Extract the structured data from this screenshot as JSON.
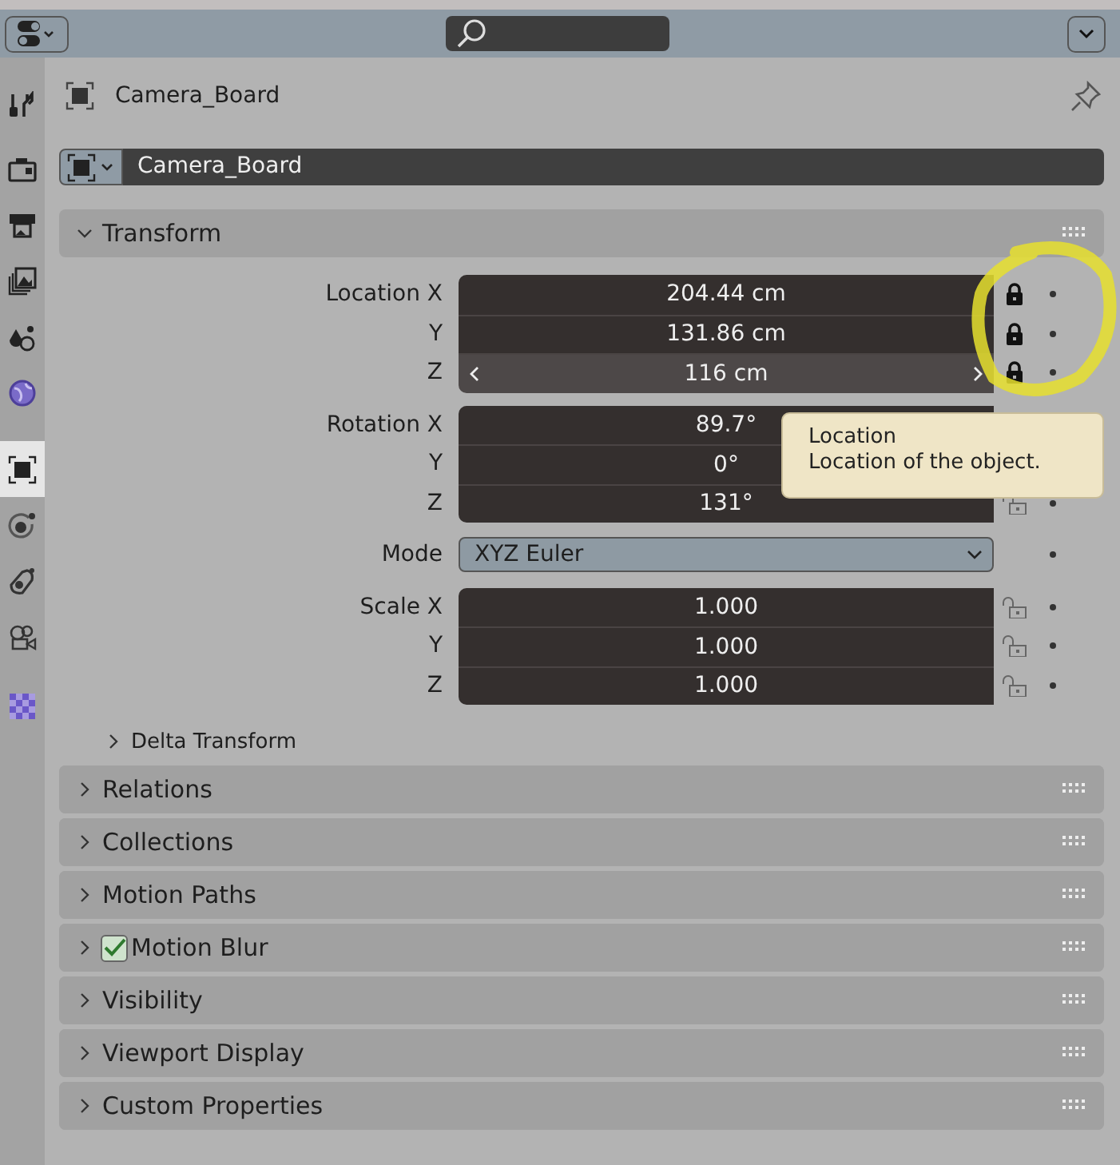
{
  "sidebar": {
    "tabs": [
      {
        "kind": "tool",
        "selected": false
      },
      {
        "kind": "render",
        "selected": false
      },
      {
        "kind": "output",
        "selected": false
      },
      {
        "kind": "view-layer",
        "selected": false
      },
      {
        "kind": "scene",
        "selected": false
      },
      {
        "kind": "world",
        "selected": false
      },
      {
        "kind": "object",
        "selected": true
      },
      {
        "kind": "physics",
        "selected": false
      },
      {
        "kind": "constraints",
        "selected": false
      },
      {
        "kind": "data",
        "selected": false
      },
      {
        "kind": "texture",
        "selected": false
      }
    ]
  },
  "object": {
    "name": "Camera_Board"
  },
  "datablock": {
    "name": "Camera_Board"
  },
  "transform": {
    "title": "Transform",
    "expanded": true,
    "groups": [
      {
        "kind": "vector",
        "rows": [
          {
            "label": "Location X",
            "value": "204.44 cm",
            "locked": true,
            "hovered": false
          },
          {
            "label": "Y",
            "value": "131.86 cm",
            "locked": true,
            "hovered": false
          },
          {
            "label": "Z",
            "value": "116 cm",
            "locked": true,
            "hovered": true
          }
        ]
      },
      {
        "kind": "vector",
        "rows": [
          {
            "label": "Rotation X",
            "value": "89.7°",
            "hovered": false
          },
          {
            "label": "Y",
            "value": "0°",
            "hovered": false
          },
          {
            "label": "Z",
            "value": "131°",
            "locked": false,
            "hovered": false
          }
        ]
      },
      {
        "kind": "dropdown",
        "label": "Mode",
        "value": "XYZ Euler"
      },
      {
        "kind": "vector",
        "rows": [
          {
            "label": "Scale X",
            "value": "1.000",
            "locked": false,
            "hovered": false
          },
          {
            "label": "Y",
            "value": "1.000",
            "locked": false,
            "hovered": false
          },
          {
            "label": "Z",
            "value": "1.000",
            "locked": false,
            "hovered": false
          }
        ]
      }
    ]
  },
  "tooltip": {
    "title": "Location",
    "description": "Location of the object."
  },
  "delta": {
    "title": "Delta Transform",
    "expanded": false
  },
  "panels": [
    {
      "kind": "plain",
      "title": "Relations",
      "expanded": false
    },
    {
      "kind": "plain",
      "title": "Collections",
      "expanded": false
    },
    {
      "kind": "plain",
      "title": "Motion Paths",
      "expanded": false
    },
    {
      "kind": "checkbox",
      "title": "Motion Blur",
      "expanded": false,
      "checked": true
    },
    {
      "kind": "plain",
      "title": "Visibility",
      "expanded": false
    },
    {
      "kind": "plain",
      "title": "Viewport Display",
      "expanded": false
    },
    {
      "kind": "plain",
      "title": "Custom Properties",
      "expanded": false
    }
  ]
}
